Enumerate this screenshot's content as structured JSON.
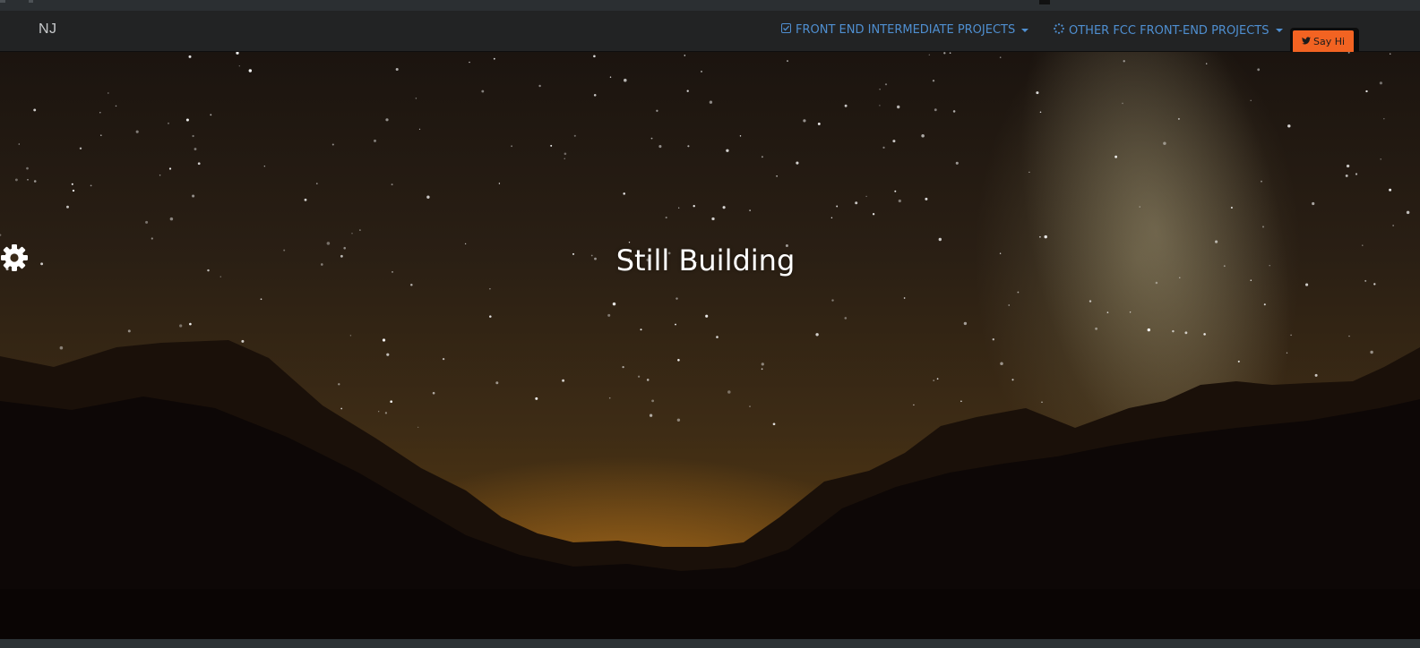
{
  "navbar": {
    "brand": "NJ",
    "links": [
      {
        "label": "FRONT END INTERMEDIATE PROJECTS",
        "icon": "checkbox-icon"
      },
      {
        "label": "OTHER FCC FRONT-END PROJECTS",
        "icon": "spinner-icon"
      }
    ],
    "cta": {
      "label": "Say Hi",
      "icon": "twitter-icon"
    }
  },
  "hero": {
    "title": "Still Building",
    "icon": "gear-icon"
  },
  "colors": {
    "navbar_bg": "#222324",
    "link": "#4f8fd1",
    "cta_bg": "#f26322",
    "title": "#ffffff"
  }
}
